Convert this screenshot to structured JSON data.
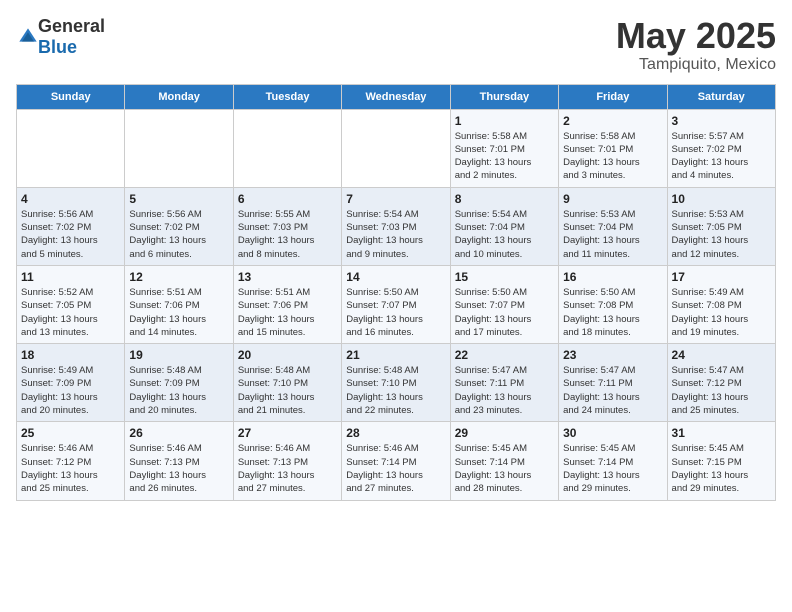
{
  "header": {
    "logo_general": "General",
    "logo_blue": "Blue",
    "title": "May 2025",
    "subtitle": "Tampiquito, Mexico"
  },
  "weekdays": [
    "Sunday",
    "Monday",
    "Tuesday",
    "Wednesday",
    "Thursday",
    "Friday",
    "Saturday"
  ],
  "weeks": [
    [
      {
        "day": "",
        "info": ""
      },
      {
        "day": "",
        "info": ""
      },
      {
        "day": "",
        "info": ""
      },
      {
        "day": "",
        "info": ""
      },
      {
        "day": "1",
        "info": "Sunrise: 5:58 AM\nSunset: 7:01 PM\nDaylight: 13 hours\nand 2 minutes."
      },
      {
        "day": "2",
        "info": "Sunrise: 5:58 AM\nSunset: 7:01 PM\nDaylight: 13 hours\nand 3 minutes."
      },
      {
        "day": "3",
        "info": "Sunrise: 5:57 AM\nSunset: 7:02 PM\nDaylight: 13 hours\nand 4 minutes."
      }
    ],
    [
      {
        "day": "4",
        "info": "Sunrise: 5:56 AM\nSunset: 7:02 PM\nDaylight: 13 hours\nand 5 minutes."
      },
      {
        "day": "5",
        "info": "Sunrise: 5:56 AM\nSunset: 7:02 PM\nDaylight: 13 hours\nand 6 minutes."
      },
      {
        "day": "6",
        "info": "Sunrise: 5:55 AM\nSunset: 7:03 PM\nDaylight: 13 hours\nand 8 minutes."
      },
      {
        "day": "7",
        "info": "Sunrise: 5:54 AM\nSunset: 7:03 PM\nDaylight: 13 hours\nand 9 minutes."
      },
      {
        "day": "8",
        "info": "Sunrise: 5:54 AM\nSunset: 7:04 PM\nDaylight: 13 hours\nand 10 minutes."
      },
      {
        "day": "9",
        "info": "Sunrise: 5:53 AM\nSunset: 7:04 PM\nDaylight: 13 hours\nand 11 minutes."
      },
      {
        "day": "10",
        "info": "Sunrise: 5:53 AM\nSunset: 7:05 PM\nDaylight: 13 hours\nand 12 minutes."
      }
    ],
    [
      {
        "day": "11",
        "info": "Sunrise: 5:52 AM\nSunset: 7:05 PM\nDaylight: 13 hours\nand 13 minutes."
      },
      {
        "day": "12",
        "info": "Sunrise: 5:51 AM\nSunset: 7:06 PM\nDaylight: 13 hours\nand 14 minutes."
      },
      {
        "day": "13",
        "info": "Sunrise: 5:51 AM\nSunset: 7:06 PM\nDaylight: 13 hours\nand 15 minutes."
      },
      {
        "day": "14",
        "info": "Sunrise: 5:50 AM\nSunset: 7:07 PM\nDaylight: 13 hours\nand 16 minutes."
      },
      {
        "day": "15",
        "info": "Sunrise: 5:50 AM\nSunset: 7:07 PM\nDaylight: 13 hours\nand 17 minutes."
      },
      {
        "day": "16",
        "info": "Sunrise: 5:50 AM\nSunset: 7:08 PM\nDaylight: 13 hours\nand 18 minutes."
      },
      {
        "day": "17",
        "info": "Sunrise: 5:49 AM\nSunset: 7:08 PM\nDaylight: 13 hours\nand 19 minutes."
      }
    ],
    [
      {
        "day": "18",
        "info": "Sunrise: 5:49 AM\nSunset: 7:09 PM\nDaylight: 13 hours\nand 20 minutes."
      },
      {
        "day": "19",
        "info": "Sunrise: 5:48 AM\nSunset: 7:09 PM\nDaylight: 13 hours\nand 20 minutes."
      },
      {
        "day": "20",
        "info": "Sunrise: 5:48 AM\nSunset: 7:10 PM\nDaylight: 13 hours\nand 21 minutes."
      },
      {
        "day": "21",
        "info": "Sunrise: 5:48 AM\nSunset: 7:10 PM\nDaylight: 13 hours\nand 22 minutes."
      },
      {
        "day": "22",
        "info": "Sunrise: 5:47 AM\nSunset: 7:11 PM\nDaylight: 13 hours\nand 23 minutes."
      },
      {
        "day": "23",
        "info": "Sunrise: 5:47 AM\nSunset: 7:11 PM\nDaylight: 13 hours\nand 24 minutes."
      },
      {
        "day": "24",
        "info": "Sunrise: 5:47 AM\nSunset: 7:12 PM\nDaylight: 13 hours\nand 25 minutes."
      }
    ],
    [
      {
        "day": "25",
        "info": "Sunrise: 5:46 AM\nSunset: 7:12 PM\nDaylight: 13 hours\nand 25 minutes."
      },
      {
        "day": "26",
        "info": "Sunrise: 5:46 AM\nSunset: 7:13 PM\nDaylight: 13 hours\nand 26 minutes."
      },
      {
        "day": "27",
        "info": "Sunrise: 5:46 AM\nSunset: 7:13 PM\nDaylight: 13 hours\nand 27 minutes."
      },
      {
        "day": "28",
        "info": "Sunrise: 5:46 AM\nSunset: 7:14 PM\nDaylight: 13 hours\nand 27 minutes."
      },
      {
        "day": "29",
        "info": "Sunrise: 5:45 AM\nSunset: 7:14 PM\nDaylight: 13 hours\nand 28 minutes."
      },
      {
        "day": "30",
        "info": "Sunrise: 5:45 AM\nSunset: 7:14 PM\nDaylight: 13 hours\nand 29 minutes."
      },
      {
        "day": "31",
        "info": "Sunrise: 5:45 AM\nSunset: 7:15 PM\nDaylight: 13 hours\nand 29 minutes."
      }
    ]
  ]
}
